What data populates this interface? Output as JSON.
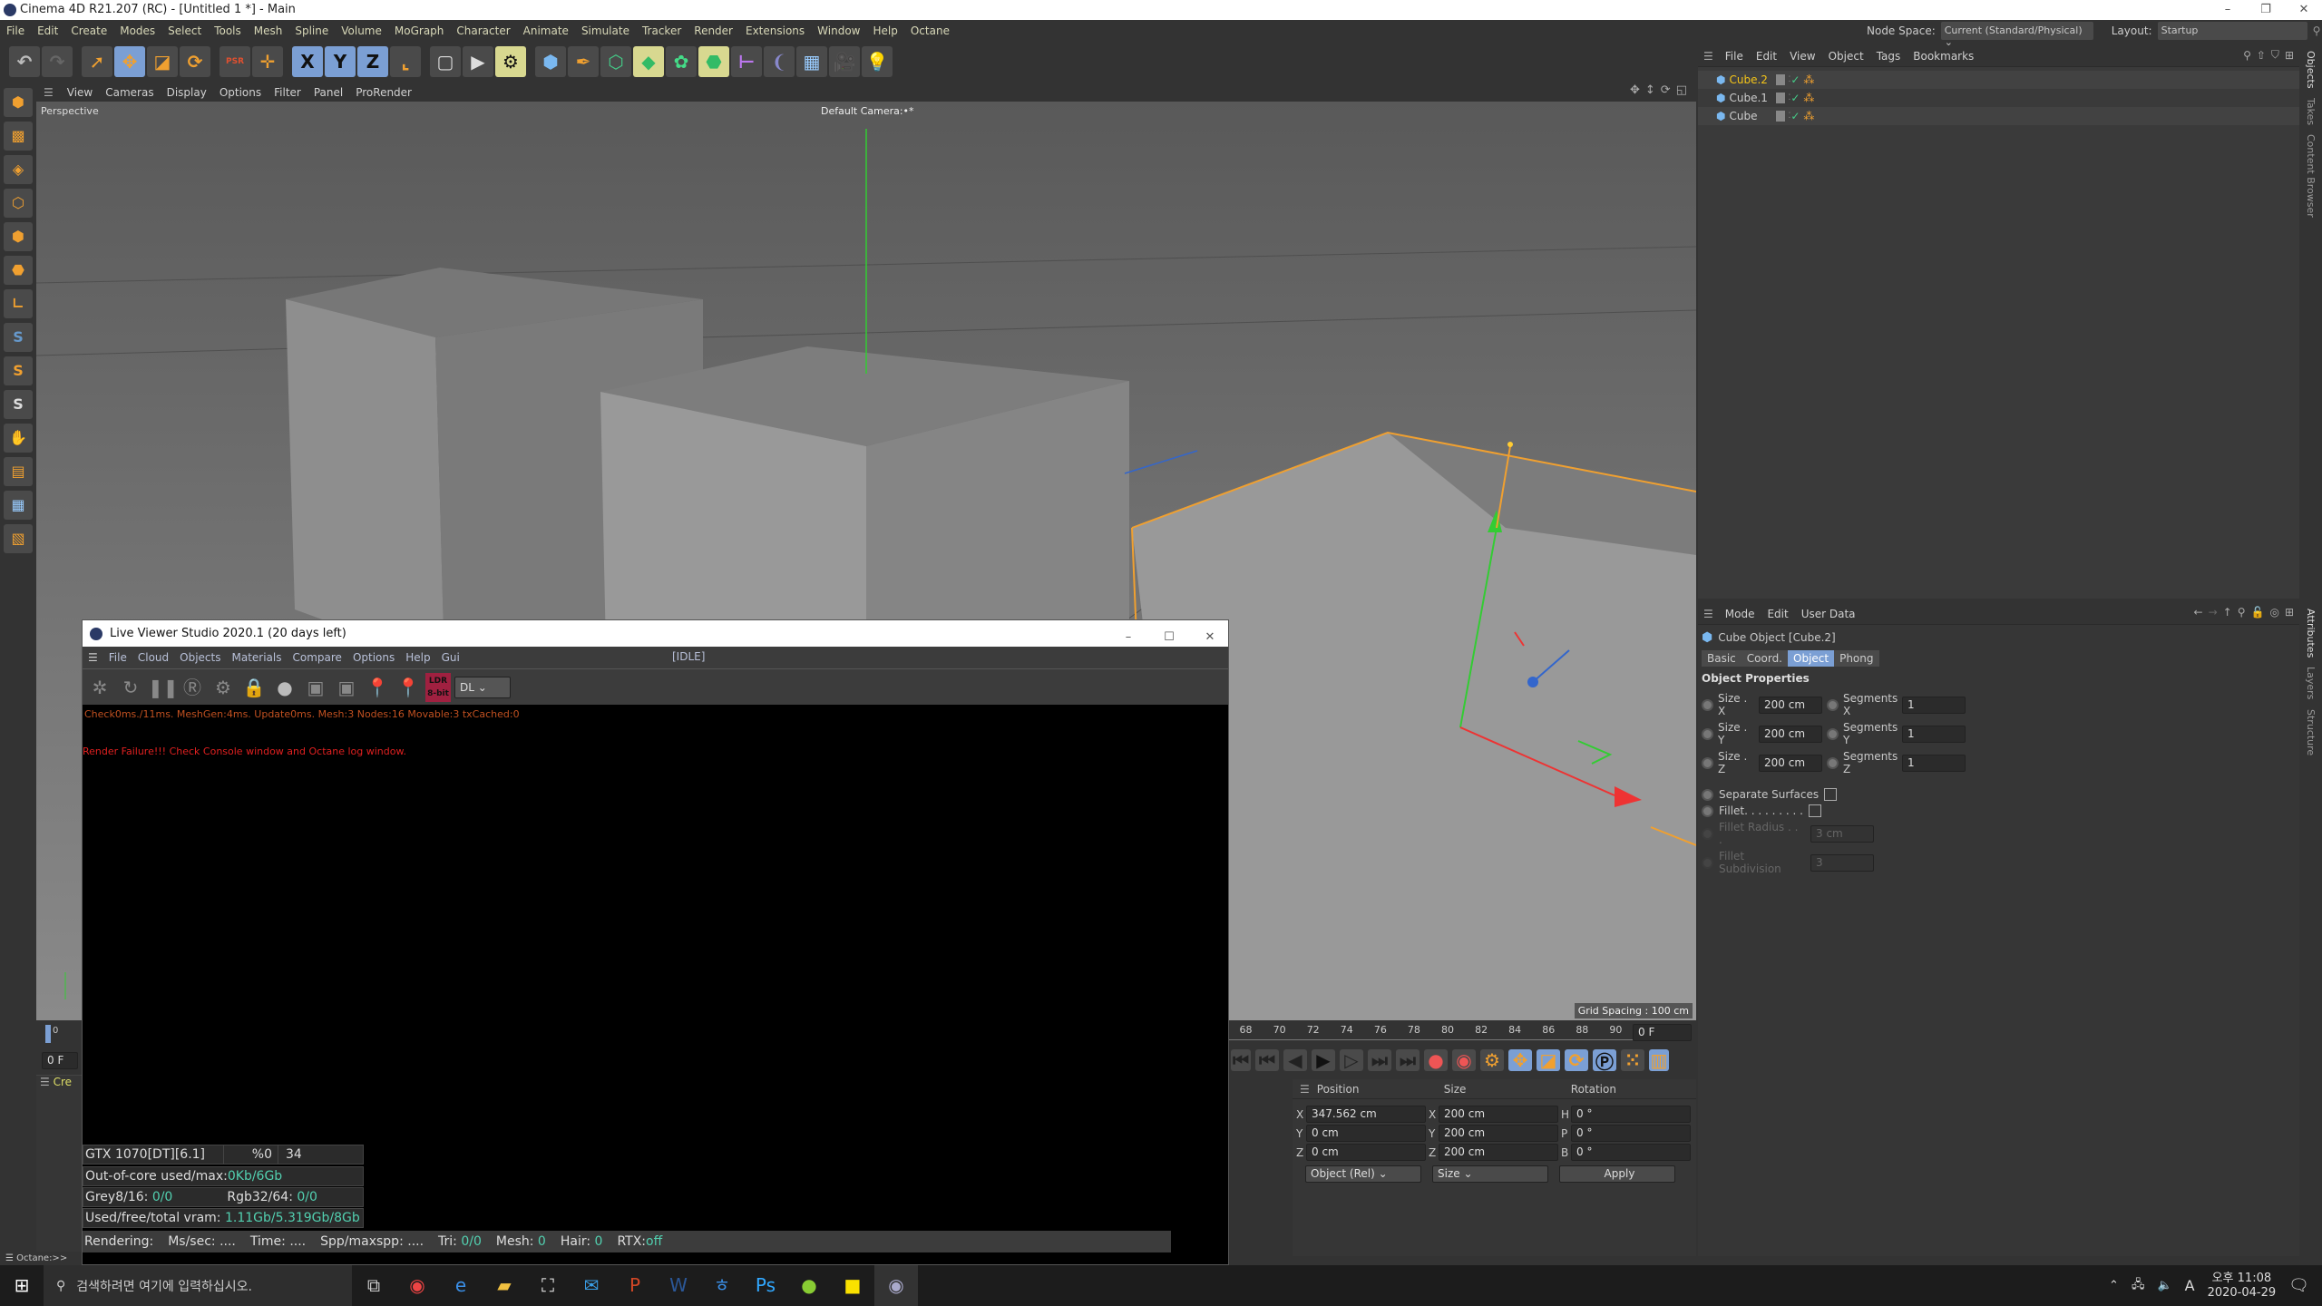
{
  "window": {
    "title": "Cinema 4D R21.207 (RC) - [Untitled 1 *] - Main",
    "minimize": "–",
    "maximize": "❐",
    "close": "✕"
  },
  "menu": [
    "File",
    "Edit",
    "Create",
    "Modes",
    "Select",
    "Tools",
    "Mesh",
    "Spline",
    "Volume",
    "MoGraph",
    "Character",
    "Animate",
    "Simulate",
    "Tracker",
    "Render",
    "Extensions",
    "Window",
    "Help",
    "Octane"
  ],
  "node_space": {
    "label": "Node Space:",
    "value": "Current (Standard/Physical)"
  },
  "layout": {
    "label": "Layout:",
    "value": "Startup"
  },
  "toolbar": [
    "undo",
    "redo",
    "select",
    "move",
    "scale",
    "rotate",
    "psr",
    "add",
    "x-axis",
    "y-axis",
    "z-axis",
    "coord-system",
    "render-region",
    "render-view",
    "render-settings",
    "cube",
    "pen",
    "subdivision",
    "extrude",
    "cloner",
    "array",
    "symmetry",
    "deformer",
    "floor",
    "camera",
    "light"
  ],
  "toolbar_text": {
    "x": "X",
    "y": "Y",
    "z": "Z",
    "psr": "PSR"
  },
  "viewport": {
    "menu": [
      "View",
      "Cameras",
      "Display",
      "Options",
      "Filter",
      "Panel",
      "ProRender"
    ],
    "label": "Perspective",
    "camera": "Default Camera:•*",
    "grid_spacing": "Grid Spacing : 100 cm"
  },
  "objects": {
    "menu": [
      "File",
      "Edit",
      "View",
      "Object",
      "Tags",
      "Bookmarks"
    ],
    "items": [
      {
        "name": "Cube.2",
        "selected": true
      },
      {
        "name": "Cube.1",
        "selected": false
      },
      {
        "name": "Cube",
        "selected": false
      }
    ]
  },
  "side_tabs": {
    "top": [
      "Objects",
      "Takes",
      "Content Browser"
    ],
    "bottom": [
      "Attributes",
      "Layers",
      "Structure"
    ]
  },
  "attributes": {
    "menu": [
      "Mode",
      "Edit",
      "User Data"
    ],
    "object_title": "Cube Object [Cube.2]",
    "tabs": [
      "Basic",
      "Coord.",
      "Object",
      "Phong"
    ],
    "active_tab": "Object",
    "section": "Object Properties",
    "size": [
      {
        "label": "Size . X",
        "value": "200 cm"
      },
      {
        "label": "Size . Y",
        "value": "200 cm"
      },
      {
        "label": "Size . Z",
        "value": "200 cm"
      }
    ],
    "segments": [
      {
        "label": "Segments X",
        "value": "1"
      },
      {
        "label": "Segments Y",
        "value": "1"
      },
      {
        "label": "Segments Z",
        "value": "1"
      }
    ],
    "separate_surfaces": {
      "label": "Separate Surfaces",
      "checked": false
    },
    "fillet": {
      "label": "Fillet. . . . . . . . .",
      "checked": false
    },
    "fillet_radius": {
      "label": "Fillet Radius . . .",
      "value": "3 cm"
    },
    "fillet_subdivision": {
      "label": "Fillet Subdivision",
      "value": "3"
    }
  },
  "timeline": {
    "ticks": [
      "68",
      "70",
      "72",
      "74",
      "76",
      "78",
      "80",
      "82",
      "84",
      "86",
      "88",
      "90"
    ],
    "current_frame": "0 F",
    "left_frame": "0 F",
    "left_tick": "0"
  },
  "coordinates": {
    "headers": [
      "Position",
      "Size",
      "Rotation"
    ],
    "position": [
      {
        "axis": "X",
        "value": "347.562 cm"
      },
      {
        "axis": "Y",
        "value": "0 cm"
      },
      {
        "axis": "Z",
        "value": "0 cm"
      }
    ],
    "size": [
      {
        "axis": "X",
        "value": "200 cm"
      },
      {
        "axis": "Y",
        "value": "200 cm"
      },
      {
        "axis": "Z",
        "value": "200 cm"
      }
    ],
    "rotation": [
      {
        "axis": "H",
        "value": "0 °"
      },
      {
        "axis": "P",
        "value": "0 °"
      },
      {
        "axis": "B",
        "value": "0 °"
      }
    ],
    "mode": "Object (Rel)",
    "size_mode": "Size",
    "apply": "Apply"
  },
  "material_panel": {
    "label": "Cre"
  },
  "console": {
    "prompt": "Octane:>> "
  },
  "live_viewer": {
    "title": "Live Viewer Studio 2020.1 (20 days left)",
    "menu": [
      "File",
      "Cloud",
      "Objects",
      "Materials",
      "Compare",
      "Options",
      "Help",
      "Gui"
    ],
    "status": "[IDLE]",
    "ldr": "LDR 8-bit",
    "mode": "DL",
    "log": "Check0ms./11ms. MeshGen:4ms. Update0ms. Mesh:3 Nodes:16 Movable:3 txCached:0",
    "error": "Render Failure!!! Check Console window and Octane log window.",
    "gpu": {
      "name": "GTX 1070[DT][6.1]",
      "percent": "%0",
      "temp": "34"
    },
    "out_of_core": {
      "label": "Out-of-core used/max:",
      "value": "0Kb/6Gb"
    },
    "grey": {
      "label": "Grey8/16: ",
      "value": "0/0"
    },
    "rgb": {
      "label": "Rgb32/64: ",
      "value": "0/0"
    },
    "vram": {
      "label": "Used/free/total vram: ",
      "value": "1.11Gb/5.319Gb/8Gb"
    },
    "rendering": {
      "label": "Rendering:",
      "ms": "Ms/sec: ....",
      "time": "Time: ....",
      "spp": "Spp/maxspp: ....",
      "tri_l": "Tri: ",
      "tri": "0/0",
      "mesh_l": "Mesh: ",
      "mesh": "0",
      "hair_l": "Hair: ",
      "hair": "0",
      "rtx_l": "RTX:",
      "rtx": "off"
    }
  },
  "taskbar": {
    "search_placeholder": "검색하려면 여기에 입력하십시오.",
    "time": "오후 11:08",
    "date": "2020-04-29",
    "ime": "A",
    "apps": [
      "task-view",
      "chrome",
      "edge",
      "explorer",
      "store",
      "mail",
      "powerpoint",
      "word",
      "hangul",
      "photoshop",
      "line",
      "kakaotalk",
      "cinema4d"
    ]
  },
  "colors": {
    "accent": "#7b9fd4",
    "selection_orange": "#f0a030",
    "selected_object": "#f5c518",
    "error": "#e02020",
    "log": "#c05020",
    "teal": "#52d0b0"
  }
}
